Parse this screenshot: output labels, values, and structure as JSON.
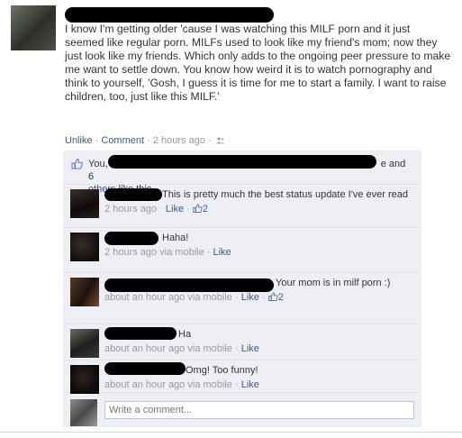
{
  "post": {
    "status_text": "I know I'm getting older 'cause I was watching this MILF porn and it just seemed like regular porn. MILFs used to look like my friend's mom; now they just look like my friends. Which only adds to the ongoing peer pressure to make me want to settle down. You know how weird it is to watch pornography and think to yourself, 'Gosh, I guess it is time for me to start a family. I want to raise children, too, just like this MILF.'",
    "actions": {
      "unlike_label": "Unlike",
      "comment_label": "Comment",
      "timestamp": "2 hours ago",
      "separator": "·"
    }
  },
  "likes": {
    "prefix": "You,",
    "suffix": "e and 6",
    "others_label": "others",
    "tail": "like this."
  },
  "comments": [
    {
      "text": "This is pretty much the best status update I've ever read",
      "time": "2 hours ago",
      "like_label": "Like",
      "like_count": "2",
      "via": ""
    },
    {
      "text": "Haha!",
      "time": "2 hours ago",
      "via": "via mobile",
      "like_label": "Like",
      "like_count": ""
    },
    {
      "text": "Your mom is in milf porn :)",
      "time": "about an hour ago",
      "via": "via mobile",
      "like_label": "Like",
      "like_count": "2"
    },
    {
      "text": "Ha",
      "time": "about an hour ago",
      "via": "via mobile",
      "like_label": "Like",
      "like_count": ""
    },
    {
      "text": "Omg! Too funny!",
      "time": "about an hour ago",
      "via": "via mobile",
      "like_label": "Like",
      "like_count": ""
    }
  ],
  "composer": {
    "placeholder": "Write a comment..."
  },
  "colors": {
    "link": "#3b5998",
    "meta": "#999999",
    "ufi_background": "#edeff4"
  }
}
